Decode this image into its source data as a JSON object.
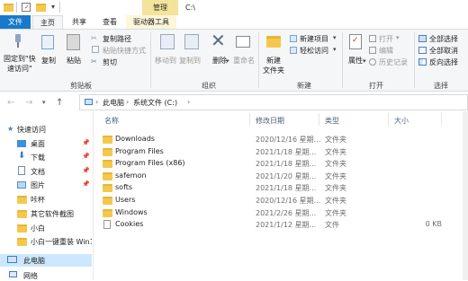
{
  "title_bar": {
    "context_tab": "管理",
    "path": "C:\\"
  },
  "tabs": {
    "file": "文件",
    "home": "主页",
    "share": "共享",
    "view": "查看",
    "drive_tools": "驱动器工具"
  },
  "ribbon": {
    "pin_quick_access": [
      "固定到\"快",
      "速访问\""
    ],
    "copy": "复制",
    "paste": "粘贴",
    "copy_path": "复制路径",
    "paste_shortcut": "粘贴快捷方式",
    "cut": "剪切",
    "group_clipboard": "剪贴板",
    "move_to": "移动到",
    "copy_to": "复制到",
    "delete": "删除",
    "rename": "重命名",
    "group_organize": "组织",
    "new_folder": [
      "新建",
      "文件夹"
    ],
    "new_item": "新建项目",
    "easy_access": "轻松访问",
    "group_new": "新建",
    "properties": "属性",
    "open": "打开",
    "edit": "编辑",
    "history": "历史记录",
    "group_open": "打开",
    "select_all": "全部选择",
    "select_none": "全部取消",
    "invert_selection": "反向选择",
    "group_select": "选择"
  },
  "address": {
    "this_pc": "此电脑",
    "drive": "系统文件 (C:)"
  },
  "columns": {
    "name": "名称",
    "modified": "修改日期",
    "type": "类型",
    "size": "大小"
  },
  "nav": {
    "quick_access": "快速访问",
    "items": [
      "桌面",
      "下载",
      "文档",
      "图片",
      "咔杯",
      "其它软件截图",
      "小白",
      "小白一键重装 Win1"
    ],
    "this_pc": "此电脑",
    "network": "网络"
  },
  "files": [
    {
      "name": "Downloads",
      "date": "2020/12/16 星期...",
      "type": "文件夹",
      "size": ""
    },
    {
      "name": "Program Files",
      "date": "2021/1/18 星期...",
      "type": "文件夹",
      "size": ""
    },
    {
      "name": "Program Files (x86)",
      "date": "2021/1/18 星期...",
      "type": "文件夹",
      "size": ""
    },
    {
      "name": "safemon",
      "date": "2021/1/20 星期...",
      "type": "文件夹",
      "size": ""
    },
    {
      "name": "softs",
      "date": "2021/1/18 星期...",
      "type": "文件夹",
      "size": ""
    },
    {
      "name": "Users",
      "date": "2020/12/16 星期...",
      "type": "文件夹",
      "size": ""
    },
    {
      "name": "Windows",
      "date": "2021/2/26 星期...",
      "type": "文件夹",
      "size": ""
    },
    {
      "name": "Cookies",
      "date": "2021/1/12 星期...",
      "type": "文件",
      "size": "0 KB"
    }
  ]
}
